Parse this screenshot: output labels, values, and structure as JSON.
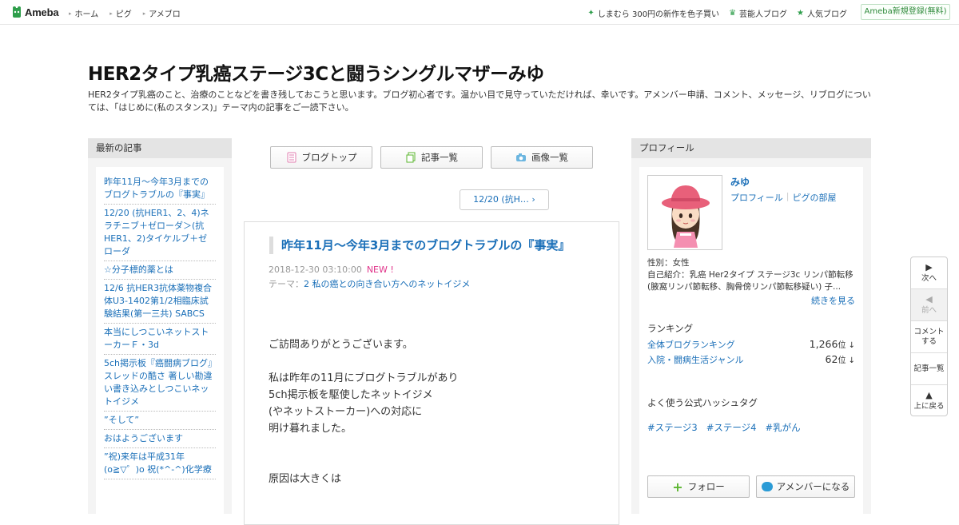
{
  "topbar": {
    "logo_text": "Ameba",
    "nav_left": [
      "ホーム",
      "ピグ",
      "アメブロ"
    ],
    "nav_right": [
      {
        "icon": "sparkle-icon",
        "label": "しまむら 300円の新作を色子買い"
      },
      {
        "icon": "crown-icon",
        "label": "芸能人ブログ"
      },
      {
        "icon": "star-icon",
        "label": "人気ブログ"
      }
    ],
    "signup_label": "Ameba新規登録(無料)"
  },
  "blog": {
    "title": "HER2タイプ乳癌ステージ3Cと闘うシングルマザーみゆ",
    "description": "HER2タイプ乳癌のこと、治療のことなどを書き残しておこうと思います。ブログ初心者です。温かい目で見守っていただければ、幸いです。アメンバー申請、コメント、メッセージ、リブログについては、「はじめに(私のスタンス)」テーマ内の記事をご一読下さい。"
  },
  "left": {
    "heading": "最新の記事",
    "recent": [
      "昨年11月～今年3月までのブログトラブルの『事実』",
      "12/20 (抗HER1、2、4)ネラチニブ＋ゼローダ＞(抗HER1、2)タイケルブ＋ゼローダ",
      "☆分子標的薬とは",
      "12/6 抗HER3抗体薬物複合体U3-1402第1/2相臨床試験結果(第一三共) SABCS",
      "本当にしつこいネットストーカーＦ・3d",
      "5ch掲示板『癌闘病ブログ』スレッドの酷さ 著しい勘違い書き込みとしつこいネットイジメ",
      "”そして”",
      "おはようございます",
      "”祝)来年は平成31年(o≧▽゜)o 祝(*^-^)化学療"
    ]
  },
  "center": {
    "buttons": [
      {
        "label": "ブログトップ",
        "icon": "document-icon"
      },
      {
        "label": "記事一覧",
        "icon": "copy-icon"
      },
      {
        "label": "画像一覧",
        "icon": "camera-icon"
      }
    ],
    "pager_label": "12/20 (抗H…",
    "article": {
      "title": "昨年11月～今年3月までのブログトラブルの『事実』",
      "date": "2018-12-30 03:10:00",
      "new_badge": "NEW !",
      "theme_prefix": "テーマ：",
      "theme": "2 私の癌との向き合い方へのネットイジメ",
      "body": [
        "ご訪問ありがとうございます。",
        "",
        "私は昨年の11月にブログトラブルがあり",
        "5ch掲示板を駆使したネットイジメ",
        "(やネットストーカー)への対応に",
        "明け暮れました。",
        "",
        "",
        "原因は大きくは"
      ]
    }
  },
  "right": {
    "heading": "プロフィール",
    "name": "みゆ",
    "links": [
      "プロフィール",
      "ピグの部屋"
    ],
    "gender": "性別：女性",
    "intro": "自己紹介：乳癌 Her2タイプ ステージ3c リンパ節転移 (腋窩リンパ節転移、胸骨傍リンパ節転移疑い) 子...",
    "more_label": "続きを見る",
    "ranking_heading": "ランキング",
    "rankings": [
      {
        "label": "全体ブログランキング",
        "value": "1,266",
        "unit": "位 ↓"
      },
      {
        "label": "入院・闘病生活ジャンル",
        "value": "62",
        "unit": "位 ↓"
      }
    ],
    "hashtag_heading": "よく使う公式ハッシュタグ",
    "hashtags": [
      "#ステージ3",
      "#ステージ4",
      "#乳がん"
    ],
    "follow_label": "フォロー",
    "amember_label": "アメンバーになる"
  },
  "floatnav": [
    {
      "icon": "play-right-icon",
      "label": "次へ",
      "disabled": false
    },
    {
      "icon": "play-left-icon",
      "label": "前へ",
      "disabled": true
    },
    {
      "icon": "comment-icon",
      "label": "コメントする",
      "disabled": false
    },
    {
      "icon": "list-icon",
      "label": "記事一覧",
      "disabled": false
    },
    {
      "icon": "up-arrow-icon",
      "label": "上に戻る",
      "disabled": false
    }
  ],
  "colors": {
    "link": "#1a6fb8",
    "accent_green": "#2e9e4b",
    "new_badge": "#e0348a"
  }
}
